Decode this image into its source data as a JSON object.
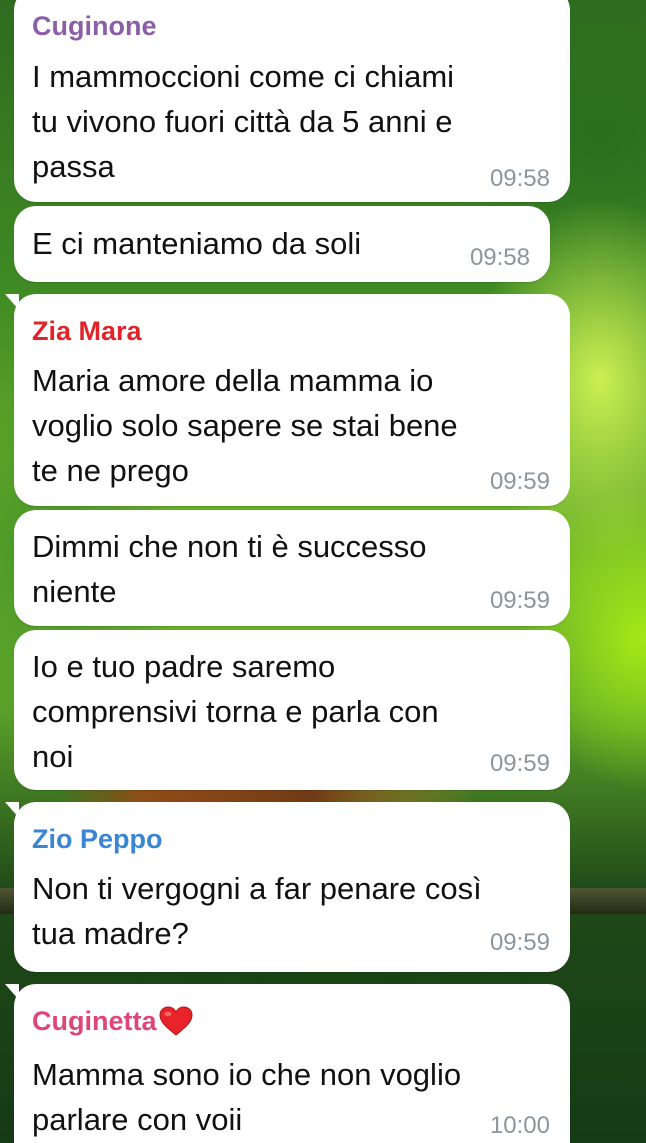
{
  "messages": [
    {
      "sender": "Cuginone",
      "sender_color": "#8b5fa8",
      "lines": [
        "I mammoccioni come ci chiami",
        "tu vivono fuori città da 5 anni e",
        "passa"
      ],
      "time": "09:58"
    },
    {
      "sender": "",
      "lines": [
        "E ci manteniamo da soli"
      ],
      "time": "09:58"
    },
    {
      "sender": "Zia Mara",
      "sender_color": "#e0242a",
      "lines": [
        "Maria amore della mamma io",
        "voglio solo sapere se stai bene",
        "te ne prego"
      ],
      "time": "09:59"
    },
    {
      "sender": "",
      "lines": [
        "Dimmi che non ti è successo",
        "niente"
      ],
      "time": "09:59"
    },
    {
      "sender": "",
      "lines": [
        "Io e tuo padre saremo",
        "comprensivi torna e parla con",
        "noi"
      ],
      "time": "09:59"
    },
    {
      "sender": "Zio Peppo",
      "sender_color": "#3a86d4",
      "lines": [
        "Non ti vergogni a far penare così",
        "tua madre?"
      ],
      "time": "09:59"
    },
    {
      "sender": "Cuginetta",
      "sender_color": "#e0457a",
      "sender_icon": "red-heart-icon",
      "lines": [
        "Mamma sono io che non voglio",
        "parlare con voii"
      ],
      "time": "10:00"
    }
  ],
  "colors": {
    "bubble": "#ffffff",
    "timestamp": "#8c959c",
    "heart": "#e8232a"
  }
}
